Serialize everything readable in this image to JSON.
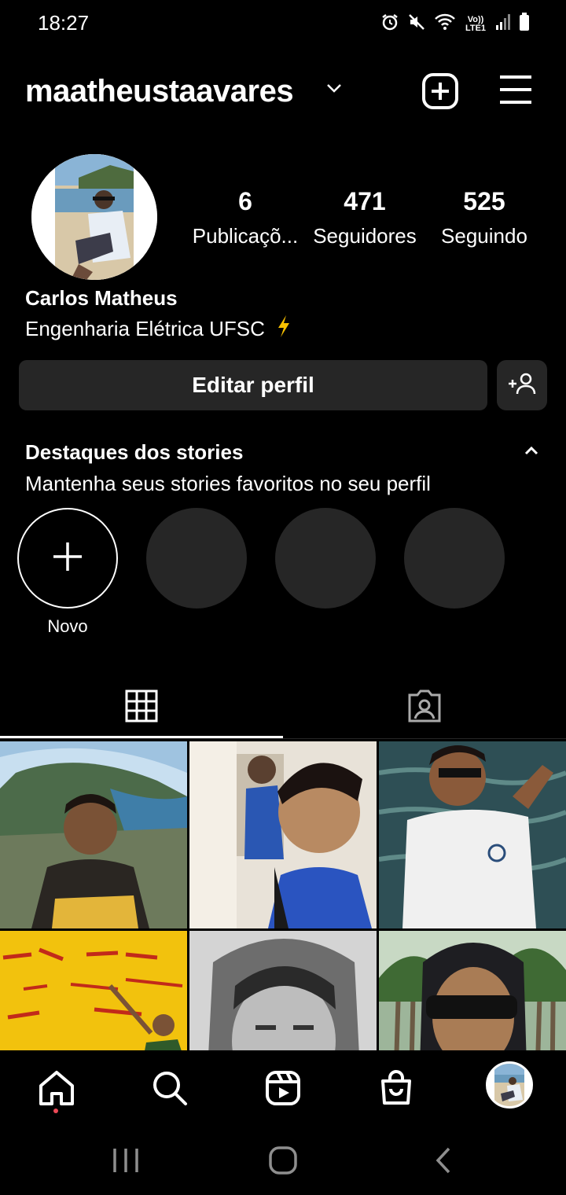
{
  "status_bar": {
    "time": "18:27",
    "network_label": "Vo)) LTE1",
    "icons": [
      "alarm-icon",
      "mute-icon",
      "wifi-icon",
      "signal-icon",
      "battery-icon"
    ]
  },
  "header": {
    "username": "maatheustaavares",
    "icons": [
      "chevron-down-icon",
      "new-post-icon",
      "menu-icon"
    ]
  },
  "profile": {
    "stats": [
      {
        "value": "6",
        "label": "Publicaçõ..."
      },
      {
        "value": "471",
        "label": "Seguidores"
      },
      {
        "value": "525",
        "label": "Seguindo"
      }
    ],
    "full_name": "Carlos Matheus",
    "bio": "Engenharia Elétrica UFSC",
    "bio_emoji": "lightning-icon",
    "edit_button": "Editar perfil"
  },
  "highlights": {
    "title": "Destaques dos stories",
    "subtitle": "Mantenha seus stories favoritos no seu perfil",
    "new_label": "Novo"
  },
  "tabs": [
    {
      "icon": "grid-icon",
      "active": true
    },
    {
      "icon": "tagged-icon",
      "active": false
    }
  ],
  "bottom_nav": [
    "home-icon",
    "search-icon",
    "reels-icon",
    "shop-icon",
    "profile-avatar"
  ],
  "colors": {
    "background": "#000000",
    "surface": "#262626",
    "text": "#ffffff",
    "notification": "#ed4956",
    "lightning": "#f7c000"
  }
}
